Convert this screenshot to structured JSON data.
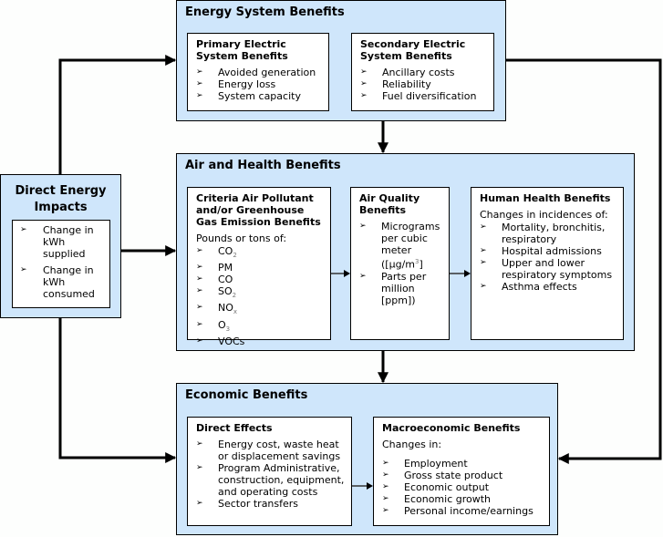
{
  "direct_energy_impacts": {
    "title_line1": "Direct Energy",
    "title_line2": "Impacts",
    "items": [
      "Change in kWh supplied",
      "Change in kWh consumed"
    ]
  },
  "energy_system": {
    "title": "Energy System Benefits",
    "primary": {
      "title_line1": "Primary Electric",
      "title_line2": "System Benefits",
      "items": [
        "Avoided generation",
        "Energy loss",
        "System capacity"
      ]
    },
    "secondary": {
      "title_line1": "Secondary Electric",
      "title_line2": "System Benefits",
      "items": [
        "Ancillary costs",
        "Reliability",
        "Fuel diversification"
      ]
    }
  },
  "air_health": {
    "title": "Air and Health Benefits",
    "criteria": {
      "title_line1": "Criteria Air Pollutant",
      "title_line2": "and/or Greenhouse",
      "title_line3": "Gas Emission Benefits",
      "intro": "Pounds or tons of:",
      "items": [
        {
          "base": "CO",
          "sub": "2"
        },
        {
          "base": "PM",
          "sub": ""
        },
        {
          "base": "CO",
          "sub": ""
        },
        {
          "base": "SO",
          "sub": "2"
        },
        {
          "base": "NO",
          "sub": "x"
        },
        {
          "base": "O",
          "sub": "3"
        },
        {
          "base": "VOCs",
          "sub": ""
        }
      ]
    },
    "air_quality": {
      "title_line1": "Air Quality",
      "title_line2": "Benefits",
      "item1_line1": "Micrograms",
      "item1_line2": "per cubic",
      "item1_line3": "meter",
      "item1_line4_pre": "([µg/m",
      "item1_line4_sup": "3",
      "item1_line4_post": "]",
      "item2_line1": "Parts per",
      "item2_line2": "million",
      "item2_line3": "[ppm])"
    },
    "human_health": {
      "title": "Human Health Benefits",
      "intro": "Changes in incidences of:",
      "items": [
        "Mortality, bronchitis, respiratory",
        "Hospital admissions",
        "Upper and lower respiratory symptoms",
        "Asthma effects"
      ]
    }
  },
  "economic": {
    "title": "Economic Benefits",
    "direct_effects": {
      "title": "Direct Effects",
      "items": [
        "Energy cost, waste heat or displacement savings",
        "Program Administrative, construction, equipment, and operating costs",
        "Sector transfers"
      ]
    },
    "macro": {
      "title": "Macroeconomic Benefits",
      "intro": "Changes in:",
      "items": [
        "Employment",
        "Gross state product",
        "Economic output",
        "Economic growth",
        "Personal income/earnings"
      ]
    }
  },
  "bullet_glyph": "➢"
}
